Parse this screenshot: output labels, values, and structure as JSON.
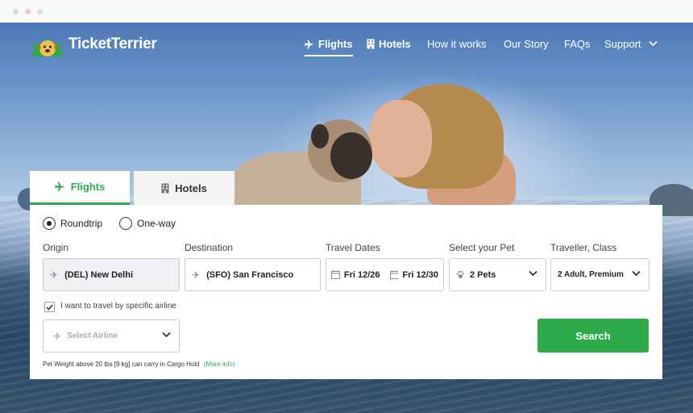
{
  "brand": {
    "name": "TicketTerrier"
  },
  "nav": {
    "items": [
      {
        "label": "Flights",
        "icon": "plane-icon"
      },
      {
        "label": "Hotels",
        "icon": "building-icon"
      },
      {
        "label": "How it works"
      },
      {
        "label": "Our Story"
      },
      {
        "label": "FAQs"
      },
      {
        "label": "Support"
      }
    ]
  },
  "tabs": [
    {
      "label": "Flights",
      "icon": "plane-icon",
      "active": true
    },
    {
      "label": "Hotels",
      "icon": "building-icon",
      "active": false
    }
  ],
  "trip_type": {
    "options": [
      {
        "label": "Roundtrip",
        "selected": true
      },
      {
        "label": "One-way",
        "selected": false
      }
    ]
  },
  "fields": {
    "origin": {
      "label": "Origin",
      "value": "(DEL) New Delhi"
    },
    "destination": {
      "label": "Destination",
      "value": "(SFO)  San Francisco"
    },
    "dates": {
      "label": "Travel Dates",
      "depart": "Fri 12/26",
      "return": "Fri 12/30"
    },
    "pet": {
      "label": "Select your Pet",
      "value": "2 Pets"
    },
    "traveller": {
      "label": "Traveller, Class",
      "value": "2 Adult, Premium"
    }
  },
  "airline_pref": {
    "checkbox_label": "I want to travel by specific airline",
    "checked": true,
    "placeholder": "Select Airline"
  },
  "search_button": "Search",
  "footnote": {
    "text": "Pet Weight above 20 lbs [9 kg] can carry in Cargo Hold",
    "link": "(More info)"
  },
  "colors": {
    "accent": "#2faa4a",
    "text": "#222222"
  }
}
